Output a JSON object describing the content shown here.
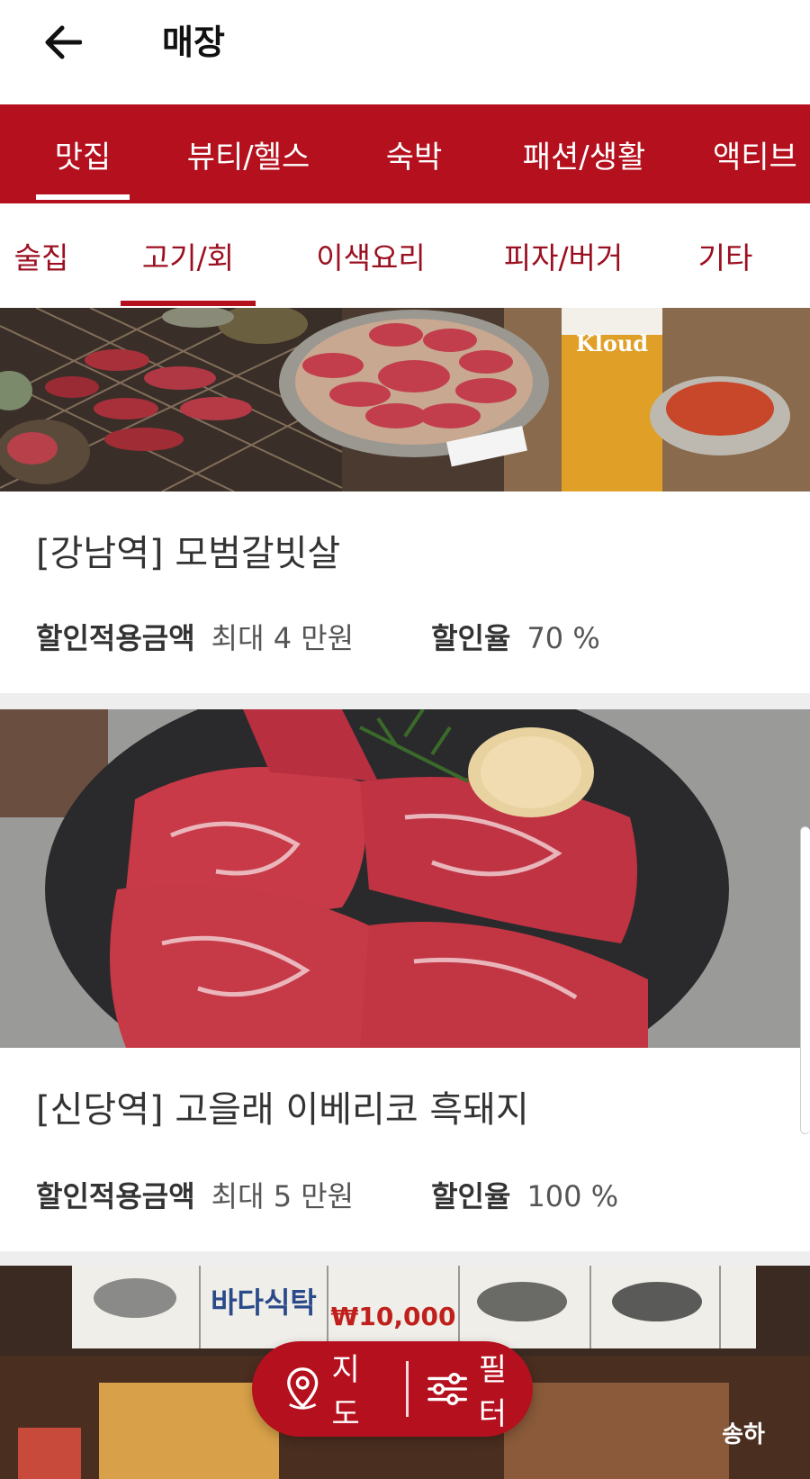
{
  "header": {
    "title": "매장"
  },
  "primary_tabs": [
    {
      "label": "맛집",
      "active": true
    },
    {
      "label": "뷰티/헬스",
      "active": false
    },
    {
      "label": "숙박",
      "active": false
    },
    {
      "label": "패션/생활",
      "active": false
    },
    {
      "label": "액티브",
      "active": false
    }
  ],
  "secondary_tabs": [
    {
      "label": "술집",
      "active": false
    },
    {
      "label": "고기/회",
      "active": true
    },
    {
      "label": "이색요리",
      "active": false
    },
    {
      "label": "피자/버거",
      "active": false
    },
    {
      "label": "기타",
      "active": false
    }
  ],
  "stores": [
    {
      "name": "[강남역] 모범갈빗살",
      "discount_amount_label": "할인적용금액",
      "discount_amount": "최대 4 만원",
      "discount_rate_label": "할인율",
      "discount_rate": "70 %",
      "photo_text": "Kloud"
    },
    {
      "name": "[신당역] 고을래 이베리코 흑돼지",
      "discount_amount_label": "할인적용금액",
      "discount_amount": "최대 5 만원",
      "discount_rate_label": "할인율",
      "discount_rate": "100 %"
    },
    {
      "photo_sign_1": "바다식탁",
      "photo_sign_2": "₩10,000",
      "photo_watermark": "송하"
    }
  ],
  "floating": {
    "map_label": "지도",
    "filter_label": "필터"
  },
  "colors": {
    "brand": "#b5101e",
    "secondary_text": "#9b1020"
  }
}
